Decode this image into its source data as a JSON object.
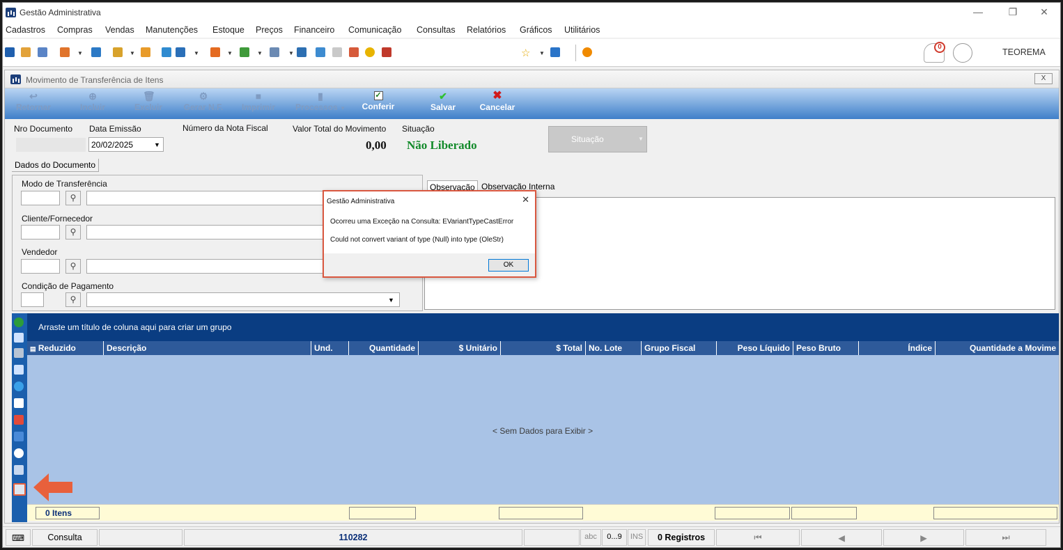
{
  "app": {
    "title": "Gestão Administrativa",
    "user": "TEOREMA",
    "notification_count": "0"
  },
  "menu": [
    "Cadastros",
    "Compras",
    "Vendas",
    "Manutenções",
    "Estoque",
    "Preços",
    "Financeiro",
    "Comunicação",
    "Consultas",
    "Relatórios",
    "Gráficos",
    "Utilitários"
  ],
  "child": {
    "title": "Movimento de Transferência de Itens",
    "close_label": "⊠"
  },
  "ribbon": {
    "retornar": "Retornar",
    "incluir": "Incluir",
    "excluir": "Excluir",
    "gerar_nf": "Gerar N.F.",
    "imprimir": "Imprimir",
    "processos": "Processos",
    "conferir": "Conferir",
    "salvar": "Salvar",
    "cancelar": "Cancelar"
  },
  "header": {
    "nro_documento_label": "Nro Documento",
    "data_emissao_label": "Data Emissão",
    "data_emissao_value": "20/02/2025",
    "numero_nf_label": "Número da Nota Fiscal",
    "valor_total_label": "Valor Total do Movimento",
    "valor_total_value": "0,00",
    "situacao_label": "Situação",
    "situacao_value": "Não Liberado",
    "situacao_button": "Situação"
  },
  "tabs": {
    "dados_documento": "Dados do Documento",
    "observacao": "Observação",
    "observacao_interna": "Observação Interna"
  },
  "form": {
    "modo_transferencia": "Modo de Transferência",
    "cliente_fornecedor": "Cliente/Fornecedor",
    "vendedor": "Vendedor",
    "condicao_pagamento": "Condição de Pagamento"
  },
  "grid": {
    "group_hint": "Arraste um título de coluna aqui para criar um grupo",
    "columns": [
      "Reduzido",
      "Descrição",
      "Und.",
      "Quantidade",
      "$ Unitário",
      "$ Total",
      "No. Lote",
      "Grupo Fiscal",
      "Peso Líquido",
      "Peso Bruto",
      "Índice",
      "Quantidade a Movime"
    ],
    "empty_text": "< Sem Dados para Exibir >",
    "footer_items": "0 Itens"
  },
  "statusbar": {
    "mode": "Consulta",
    "code": "110282",
    "abc": "abc",
    "num": "0...9",
    "ins": "INS",
    "registros": "0 Registros"
  },
  "dialog": {
    "title": "Gestão Administrativa",
    "message1": "Ocorreu uma Exceção na Consulta: EVariantTypeCastError",
    "message2": "Could not convert variant of type (Null) into type (OleStr)",
    "ok": "OK"
  },
  "colors": {
    "ribbon": "#3f7fc9",
    "grid_header": "#0a3d82",
    "grid_body": "#a9c3e6",
    "status_green": "#128a2a",
    "dialog_border": "#d9573f",
    "arrow": "#e8603c"
  }
}
